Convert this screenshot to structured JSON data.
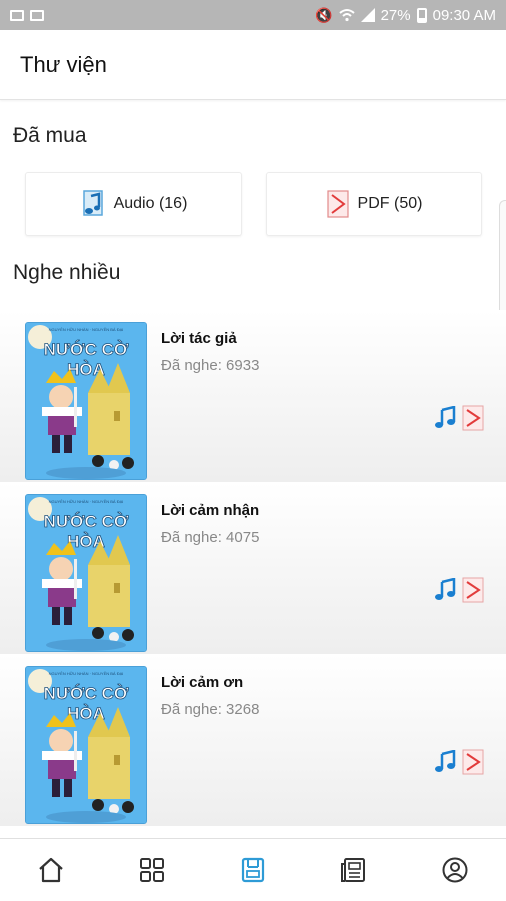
{
  "status_bar": {
    "left_icons": [
      "picture-icon",
      "mail-icon"
    ],
    "right_icons": [
      "mute-icon",
      "wifi-icon",
      "signal-icon"
    ],
    "battery_percent": "27%",
    "battery_level": 0.27,
    "time": "09:30 AM"
  },
  "app_bar": {
    "title": "Thư viện"
  },
  "purchased": {
    "heading": "Đã mua",
    "audio_label": "Audio (16)",
    "pdf_label": "PDF (50)"
  },
  "popular": {
    "heading": "Nghe nhiều",
    "items": [
      {
        "title": "Lời tác giả",
        "plays": "Đã nghe: 6933",
        "cover_title_top": "NƯỚC CỜ",
        "cover_title_bottom": "HÒA"
      },
      {
        "title": "Lời cảm nhận",
        "plays": "Đã nghe: 4075",
        "cover_title_top": "NƯỚC CỜ",
        "cover_title_bottom": "HÒA"
      },
      {
        "title": "Lời cảm ơn",
        "plays": "Đã nghe: 3268",
        "cover_title_top": "NƯỚC CỜ",
        "cover_title_bottom": "HÒA"
      }
    ]
  },
  "bottom_nav": {
    "items": [
      "home-icon",
      "grid-icon",
      "library-icon",
      "news-icon",
      "profile-icon"
    ],
    "active": "library-icon",
    "active_color": "#2e9bd6",
    "inactive_color": "#333333"
  },
  "colors": {
    "accent": "#2e9bd6",
    "audio_note": "#1a7fd0",
    "pdf_red": "#e23b3b",
    "status_bar": "#b6b6b6"
  }
}
